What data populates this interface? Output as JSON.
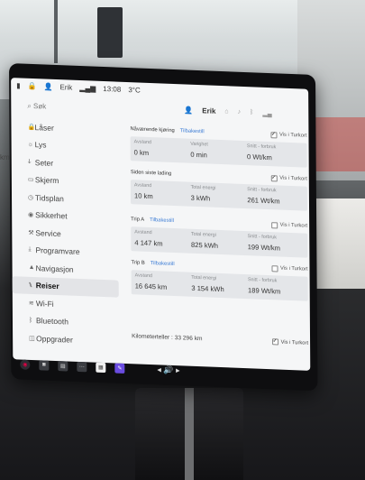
{
  "status": {
    "user": "Erik",
    "time": "13:08",
    "temp": "3°C"
  },
  "search_placeholder": "Søk",
  "edge_text": "km",
  "sidebar": {
    "items": [
      {
        "label": "Låser",
        "icon": "lock-icon"
      },
      {
        "label": "Lys",
        "icon": "light-icon"
      },
      {
        "label": "Seter",
        "icon": "seat-icon"
      },
      {
        "label": "Skjerm",
        "icon": "display-icon"
      },
      {
        "label": "Tidsplan",
        "icon": "clock-icon"
      },
      {
        "label": "Sikkerhet",
        "icon": "shield-icon"
      },
      {
        "label": "Service",
        "icon": "wrench-icon"
      },
      {
        "label": "Programvare",
        "icon": "download-icon"
      },
      {
        "label": "Navigasjon",
        "icon": "navigation-icon"
      },
      {
        "label": "Reiser",
        "icon": "trips-icon",
        "active": true
      },
      {
        "label": "Wi-Fi",
        "icon": "wifi-icon"
      },
      {
        "label": "Bluetooth",
        "icon": "bluetooth-icon"
      },
      {
        "label": "Oppgrader",
        "icon": "bag-icon"
      }
    ]
  },
  "content": {
    "user": "Erik",
    "sections": [
      {
        "title": "Nåværende kjøring",
        "reset": "Tilbakestill",
        "show_label": "Vis i Turkort",
        "checked": true,
        "cells": [
          {
            "label": "Avstand",
            "value": "0 km"
          },
          {
            "label": "Varighet",
            "value": "0 min"
          },
          {
            "label": "Snitt - forbruk",
            "value": "0 Wt/km"
          }
        ]
      },
      {
        "title": "Siden siste lading",
        "reset": "",
        "show_label": "Vis i Turkort",
        "checked": true,
        "cells": [
          {
            "label": "Avstand",
            "value": "10 km"
          },
          {
            "label": "Total energi",
            "value": "3 kWh"
          },
          {
            "label": "Snitt - forbruk",
            "value": "261 Wt/km"
          }
        ]
      },
      {
        "title": "Trip A",
        "reset": "Tilbakestill",
        "show_label": "Vis i Turkort",
        "checked": false,
        "cells": [
          {
            "label": "Avstand",
            "value": "4 147 km"
          },
          {
            "label": "Total energi",
            "value": "825 kWh"
          },
          {
            "label": "Snitt - forbruk",
            "value": "199 Wt/km"
          }
        ]
      },
      {
        "title": "Trip B",
        "reset": "Tilbakestill",
        "show_label": "Vis i Turkort",
        "checked": false,
        "cells": [
          {
            "label": "Avstand",
            "value": "16 645 km"
          },
          {
            "label": "Total energi",
            "value": "3 154 kWh"
          },
          {
            "label": "Snitt - forbruk",
            "value": "189 Wt/km"
          }
        ]
      }
    ],
    "odometer": {
      "label": "Kilometerteller : 33 296 km",
      "show_label": "Vis i Turkort",
      "checked": true
    }
  }
}
